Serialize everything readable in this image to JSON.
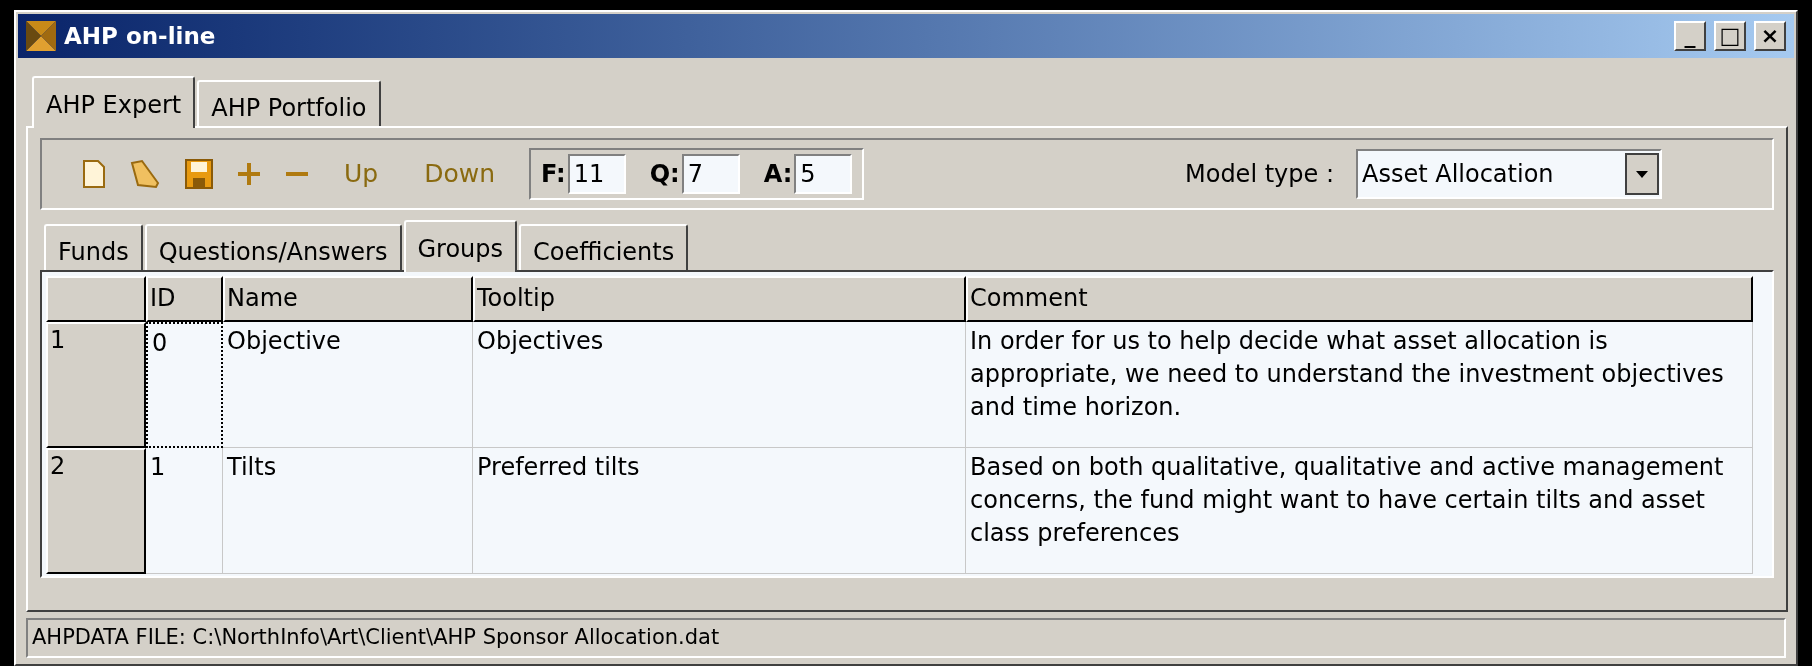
{
  "window": {
    "title": "AHP on-line",
    "controls": [
      "_",
      "□",
      "×"
    ]
  },
  "main_tabs": [
    {
      "label": "AHP Expert",
      "selected": true
    },
    {
      "label": "AHP Portfolio",
      "selected": false
    }
  ],
  "toolbar": {
    "text_buttons": [
      "Up",
      "Down"
    ],
    "fields": [
      {
        "label": "F:",
        "value": "11"
      },
      {
        "label": "Q:",
        "value": "7"
      },
      {
        "label": "A:",
        "value": "5"
      }
    ],
    "model_type": {
      "label": "Model type :",
      "value": "Asset Allocation"
    }
  },
  "sub_tabs": [
    {
      "label": "Funds",
      "selected": false
    },
    {
      "label": "Questions/Answers",
      "selected": false
    },
    {
      "label": "Groups",
      "selected": true
    },
    {
      "label": "Coefficients",
      "selected": false
    }
  ],
  "table": {
    "columns": [
      "ID",
      "Name",
      "Tooltip",
      "Comment"
    ],
    "rows": [
      {
        "number": "1",
        "id": "0",
        "name": "Objective",
        "tooltip": "Objectives",
        "comment": "In order for us to help decide what asset allocation is appropriate, we need to understand the investment objectives and time horizon.",
        "focused": true
      },
      {
        "number": "2",
        "id": "1",
        "name": "Tilts",
        "tooltip": "Preferred tilts",
        "comment": "Based on both qualitative, qualitative and active management concerns, the fund might want to have certain tilts and asset class preferences",
        "focused": false
      }
    ]
  },
  "status_bar": "AHPDATA FILE: C:\\NorthInfo\\Art\\Client\\AHP Sponsor Allocation.dat"
}
